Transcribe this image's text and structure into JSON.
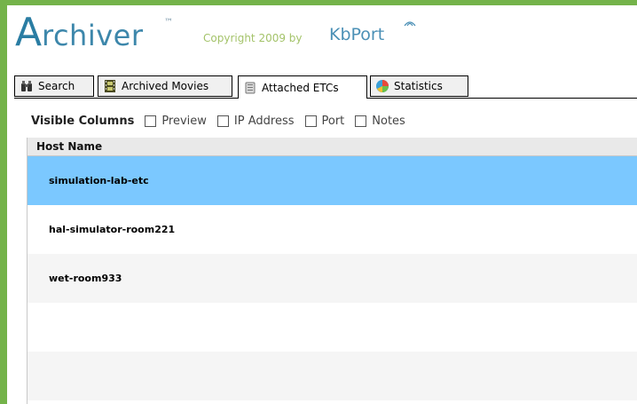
{
  "brand": {
    "logo_initial": "A",
    "logo_rest": "rchiver",
    "trademark": "™",
    "copyright": "Copyright 2009 by",
    "company": "KbPort"
  },
  "tabs": [
    {
      "label": "Search",
      "icon": "binoculars-icon",
      "active": false
    },
    {
      "label": "Archived Movies",
      "icon": "film-icon",
      "active": false
    },
    {
      "label": "Attached ETCs",
      "icon": "device-icon",
      "active": true
    },
    {
      "label": "Statistics",
      "icon": "pie-chart-icon",
      "active": false
    }
  ],
  "visible_columns": {
    "label": "Visible Columns",
    "options": [
      {
        "label": "Preview",
        "checked": false
      },
      {
        "label": "IP Address",
        "checked": false
      },
      {
        "label": "Port",
        "checked": false
      },
      {
        "label": "Notes",
        "checked": false
      }
    ]
  },
  "grid": {
    "header": "Host Name",
    "rows": [
      {
        "host": "simulation-lab-etc",
        "selected": true
      },
      {
        "host": "hal-simulator-room221",
        "selected": false
      },
      {
        "host": "wet-room933",
        "selected": false
      },
      {
        "host": "",
        "selected": false
      },
      {
        "host": "",
        "selected": false
      }
    ]
  },
  "colors": {
    "frame": "#74b34a",
    "selection": "#7bc8ff",
    "brand_blue": "#3d87ab",
    "brand_green": "#a4c36a"
  }
}
